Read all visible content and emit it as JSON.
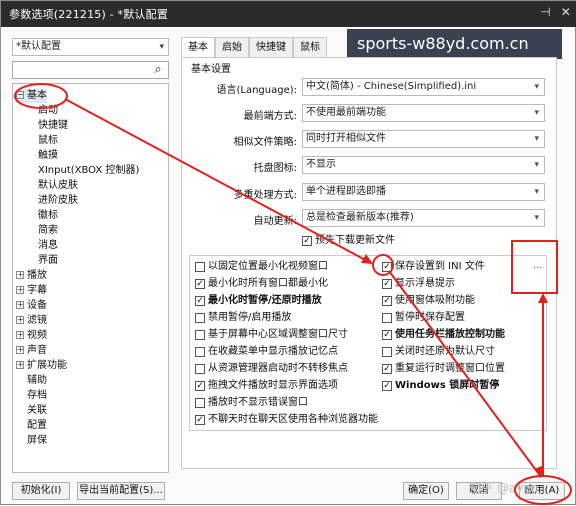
{
  "window": {
    "title": "参数选项(221215) - *默认配置",
    "controls": [
      "⊣",
      "✕"
    ]
  },
  "watermark_text": "sports-w88yd.com.cn",
  "watermark_corner": "知乎 @ayno",
  "profile_combo": {
    "value": "*默认配置"
  },
  "search": {
    "icon": "search-icon"
  },
  "tree": [
    {
      "label": "基本",
      "pm": "−"
    },
    {
      "label": "启动"
    },
    {
      "label": "快捷键"
    },
    {
      "label": "鼠标"
    },
    {
      "label": "触摸"
    },
    {
      "label": "XInput(XBOX 控制器)"
    },
    {
      "label": "默认皮肤"
    },
    {
      "label": "进阶皮肤"
    },
    {
      "label": "徽标"
    },
    {
      "label": "简索"
    },
    {
      "label": "消息"
    },
    {
      "label": "界面"
    },
    {
      "label": "播放",
      "pm": "+"
    },
    {
      "label": "字幕",
      "pm": "+"
    },
    {
      "label": "设备",
      "pm": "+"
    },
    {
      "label": "滤镜",
      "pm": "+"
    },
    {
      "label": "视频",
      "pm": "+"
    },
    {
      "label": "声音",
      "pm": "+"
    },
    {
      "label": "扩展功能",
      "pm": "+"
    },
    {
      "label": "辅助"
    },
    {
      "label": "存档"
    },
    {
      "label": "关联"
    },
    {
      "label": "配置"
    },
    {
      "label": "屏保"
    }
  ],
  "tabs": [
    "基本",
    "启始",
    "快捷键",
    "鼠标"
  ],
  "group_title": "基本设置",
  "settings": [
    {
      "label": "语言(Language):",
      "value": "中文(简体) - Chinese(Simplified).ini"
    },
    {
      "label": "最前端方式:",
      "value": "不使用最前端功能"
    },
    {
      "label": "相似文件策略:",
      "value": "同时打开相似文件"
    },
    {
      "label": "托盘图标:",
      "value": "不显示"
    },
    {
      "label": "多重处理方式:",
      "value": "单个进程即选即播"
    },
    {
      "label": "自动更新:",
      "value": "总是检查最新版本(推荐)"
    }
  ],
  "predownload": {
    "label": "预先下载更新文件",
    "checked": "✓"
  },
  "options_left": [
    {
      "label": "以固定位置最小化视频窗口",
      "checked": ""
    },
    {
      "label": "最小化时所有窗口都最小化",
      "checked": "✓"
    },
    {
      "label": "最小化时暂停/还原时播放",
      "checked": "✓",
      "bold": true
    },
    {
      "label": "禁用暂停/启用播放",
      "checked": ""
    },
    {
      "label": "基于屏幕中心区域调整窗口尺寸",
      "checked": ""
    },
    {
      "label": "在收藏菜单中显示播放记忆点",
      "checked": ""
    },
    {
      "label": "从资源管理器启动时不转移焦点",
      "checked": ""
    },
    {
      "label": "拖拽文件播放时显示界面选项",
      "checked": "✓"
    },
    {
      "label": "播放时不显示错误窗口",
      "checked": ""
    },
    {
      "label": "不聊天时在聊天区使用各种浏览器功能",
      "checked": "✓"
    }
  ],
  "options_right": [
    {
      "label": "保存设置到 INI 文件",
      "checked": "✓"
    },
    {
      "label": "显示浮悬提示",
      "checked": "✓"
    },
    {
      "label": "使用窗体吸附功能",
      "checked": "✓"
    },
    {
      "label": "暂停时保存配置",
      "checked": ""
    },
    {
      "label": "使用任务栏播放控制功能",
      "checked": "✓",
      "bold": true
    },
    {
      "label": "关闭时还原为默认尺寸",
      "checked": ""
    },
    {
      "label": "重复运行时调整窗口位置",
      "checked": "✓"
    },
    {
      "label": "Windows 锁屏时暂停",
      "checked": "✓",
      "bold": true
    }
  ],
  "ini_more": "...",
  "buttons": {
    "init": "初始化(I)",
    "export": "导出当前配置(S)...",
    "ok": "确定(O)",
    "cancel": "取消",
    "apply": "应用(A)"
  },
  "colors": {
    "annotation_red": "#e1211c",
    "titlebar": "#2b2b2b"
  }
}
